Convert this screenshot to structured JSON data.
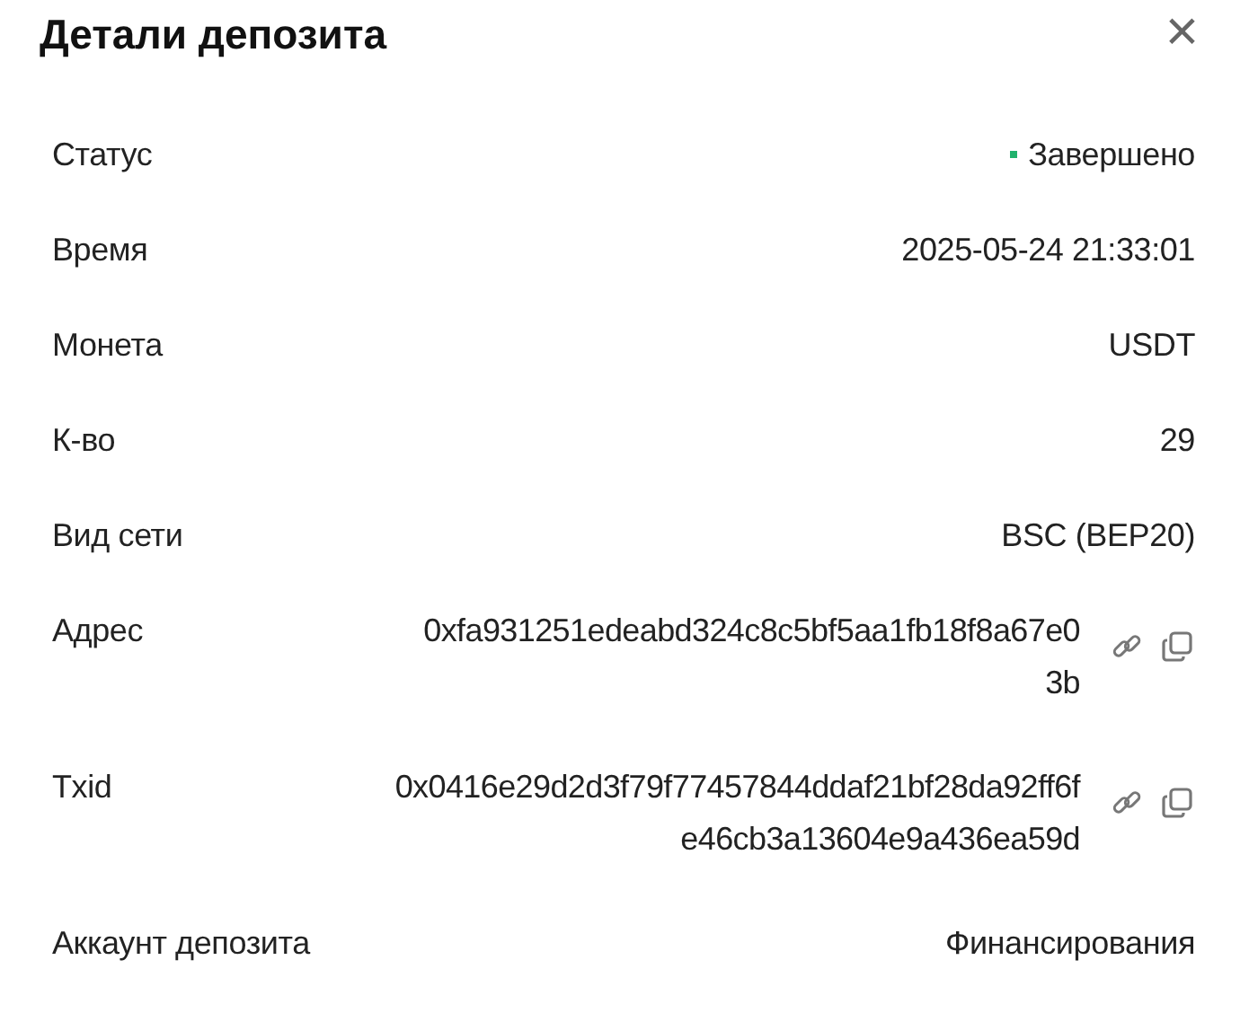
{
  "dialog": {
    "title": "Детали депозита",
    "close": "×"
  },
  "rows": [
    {
      "kind": "status",
      "label": "Статус",
      "value": "Завершено",
      "color": "#20b26c"
    },
    {
      "kind": "text",
      "label": "Время",
      "value": "2025-05-24 21:33:01"
    },
    {
      "kind": "text",
      "label": "Монета",
      "value": "USDT"
    },
    {
      "kind": "text",
      "label": "К-во",
      "value": "29"
    },
    {
      "kind": "text",
      "label": "Вид сети",
      "value": "BSC (BEP20)"
    },
    {
      "kind": "hash",
      "label": "Адрес",
      "value_lines": [
        "0xfa931251edeabd324c8c5bf5aa1fb18f8a67e0",
        "3b"
      ]
    },
    {
      "kind": "hash",
      "label": "Txid",
      "value_lines": [
        "0x0416e29d2d3f79f77457844ddaf21bf28da92ff6f",
        "e46cb3a13604e9a436ea59d"
      ]
    },
    {
      "kind": "text",
      "label": "Аккаунт депозита",
      "value": "Финансирования"
    }
  ]
}
